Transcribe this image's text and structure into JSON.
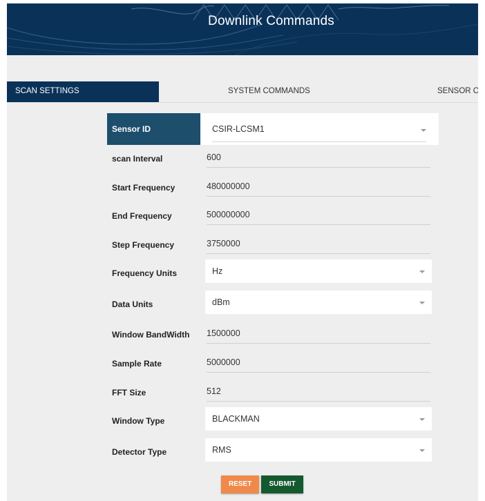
{
  "header": {
    "title": "Downlink Commands"
  },
  "tabs": [
    {
      "label": "SCAN SETTINGS",
      "active": true
    },
    {
      "label": "SYSTEM COMMANDS",
      "active": false
    },
    {
      "label": "SENSOR C",
      "active": false
    }
  ],
  "form": {
    "sensor_id": {
      "label": "Sensor ID",
      "value": "CSIR-LCSM1"
    },
    "scan_interval": {
      "label": "scan Interval",
      "value": "600"
    },
    "start_frequency": {
      "label": "Start Frequency",
      "value": "480000000"
    },
    "end_frequency": {
      "label": "End Frequency",
      "value": "500000000"
    },
    "step_frequency": {
      "label": "Step Frequency",
      "value": "3750000"
    },
    "frequency_units": {
      "label": "Frequency Units",
      "value": "Hz"
    },
    "data_units": {
      "label": "Data Units",
      "value": "dBm"
    },
    "window_bandwidth": {
      "label": "Window BandWidth",
      "value": "1500000"
    },
    "sample_rate": {
      "label": "Sample Rate",
      "value": "5000000"
    },
    "fft_size": {
      "label": "FFT Size",
      "value": "512"
    },
    "window_type": {
      "label": "Window Type",
      "value": "BLACKMAN"
    },
    "detector_type": {
      "label": "Detector Type",
      "value": "RMS"
    }
  },
  "buttons": {
    "reset": "RESET",
    "submit": "SUBMIT"
  },
  "colors": {
    "header_bg": "#0a3259",
    "active_tab": "#0a3259",
    "label_highlight": "#1d4e6c",
    "reset_button": "#f0894a",
    "submit_button": "#15592f"
  },
  "icons": {
    "dropdown": "chevron-down-icon"
  }
}
